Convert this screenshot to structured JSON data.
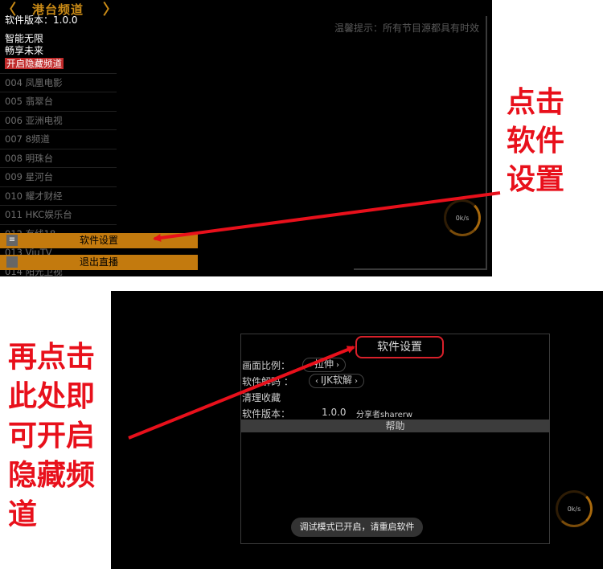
{
  "top": {
    "header_title": "港台频道",
    "arrow_left": "〈",
    "arrow_right": "〉",
    "version_line": "软件版本：1.0.0",
    "slogan_1": "智能无限",
    "slogan_2": "畅享未来",
    "hidden_toggle": "开启隐藏频道",
    "channels": [
      "004 凤凰电影",
      "005 翡翠台",
      "006 亚洲电视",
      "007 8频道",
      "008 明珠台",
      "009 星河台",
      "010 耀才财经",
      "011 HKC娱乐台",
      "012 有线18",
      "013 ViuTV",
      "014 阳光卫视"
    ],
    "notice": "温馨提示：所有节目源都具有时效",
    "speed": "0k/s",
    "menu_settings": "软件设置",
    "menu_exit": "退出直播",
    "menu_icon": "≡"
  },
  "callout_top": [
    "点击",
    "软件",
    "设置"
  ],
  "callout_bottom": [
    "再点击",
    "此处即",
    "可开启",
    "隐藏频",
    "道"
  ],
  "bottom": {
    "panel_title": "软件设置",
    "aspect_label": "画面比例：",
    "aspect_value": "拉伸",
    "decode_label": "软件解码 ：",
    "decode_value": "IJK软解",
    "clear_fav": "清理收藏",
    "version_label": "软件版本：",
    "version_value": "1.0.0",
    "sharer": "分享者sharerw",
    "help": "帮助",
    "toast": "调试模式已开启，请重启软件",
    "speed": "0k/s",
    "chev_left": "‹",
    "chev_right": "›"
  },
  "colors": {
    "accent": "#c37a0e",
    "callout": "#e8101b"
  }
}
